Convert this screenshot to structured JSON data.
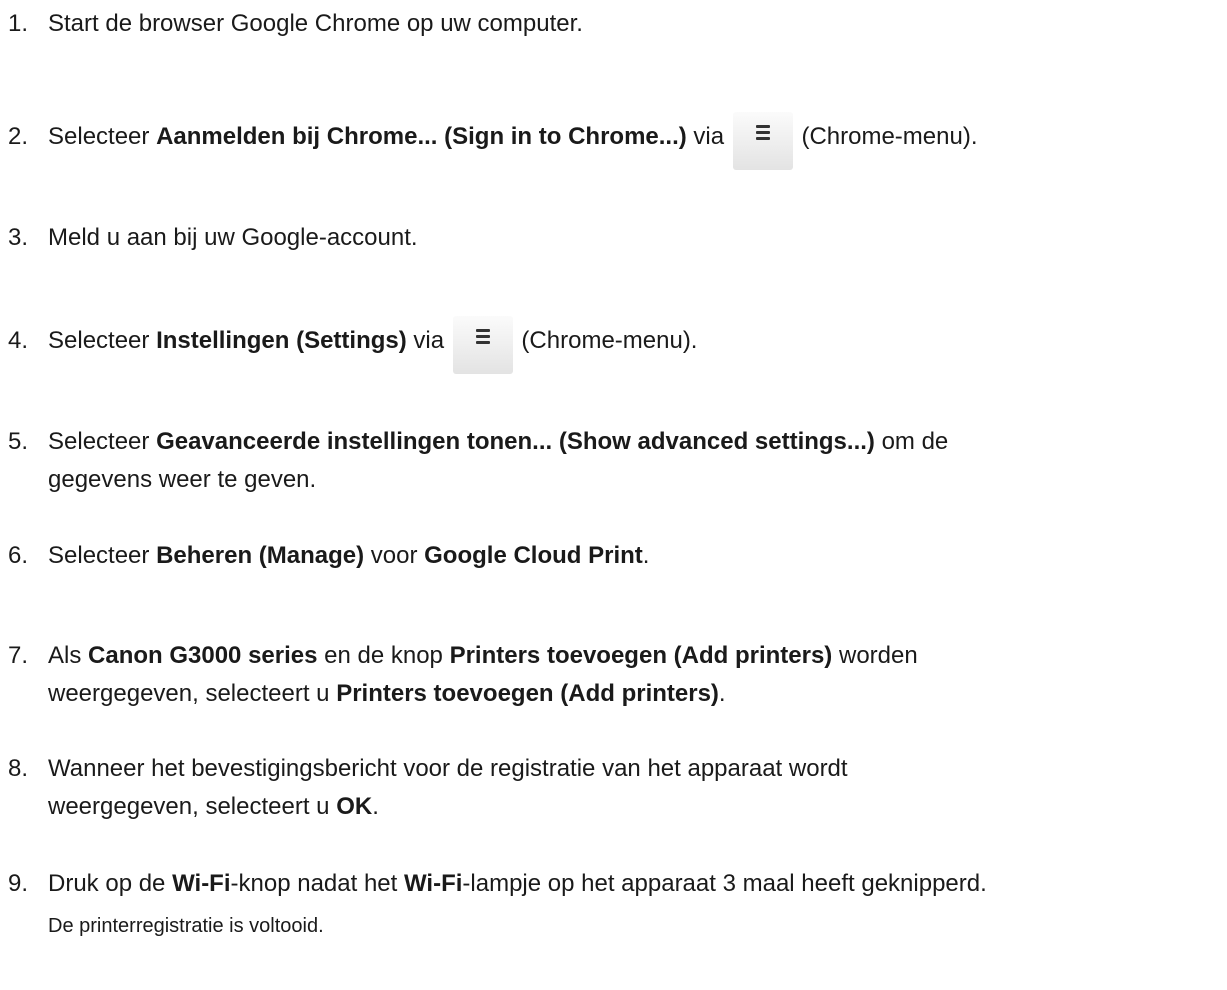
{
  "steps": [
    {
      "num": "1.",
      "text": "Start de browser Google Chrome op uw computer."
    },
    {
      "num": "2.",
      "t1": "Selecteer ",
      "b1": "Aanmelden bij Chrome... (Sign in to Chrome...)",
      "t2": " via ",
      "t3": " (Chrome-menu)."
    },
    {
      "num": "3.",
      "text": "Meld u aan bij uw Google-account."
    },
    {
      "num": "4.",
      "t1": "Selecteer ",
      "b1": "Instellingen (Settings)",
      "t2": " via ",
      "t3": " (Chrome-menu)."
    },
    {
      "num": "5.",
      "t1": "Selecteer ",
      "b1": "Geavanceerde instellingen tonen... (Show advanced settings...)",
      "t2": " om de",
      "line2": "gegevens weer te geven."
    },
    {
      "num": "6.",
      "t1": "Selecteer ",
      "b1": "Beheren (Manage)",
      "t2": " voor ",
      "b2": "Google Cloud Print",
      "t3": "."
    },
    {
      "num": "7.",
      "t1": "Als ",
      "b1": "Canon G3000 series",
      "t2": " en de knop ",
      "b2": "Printers toevoegen (Add printers)",
      "t3": " worden",
      "l2t1": "weergegeven, selecteert u ",
      "l2b1": "Printers toevoegen (Add printers)",
      "l2t2": "."
    },
    {
      "num": "8.",
      "t1": "Wanneer het bevestigingsbericht voor de registratie van het apparaat wordt",
      "l2t1": "weergegeven, selecteert u ",
      "l2b1": "OK",
      "l2t2": "."
    },
    {
      "num": "9.",
      "t1": "Druk op de ",
      "b1": "Wi-Fi",
      "t2": "-knop nadat het ",
      "b2": "Wi-Fi",
      "t3": "-lampje op het apparaat 3 maal heeft geknipperd."
    }
  ],
  "result": "De printerregistratie is voltooid.",
  "icons": {
    "chrome_menu": "hamburger-menu-icon"
  }
}
